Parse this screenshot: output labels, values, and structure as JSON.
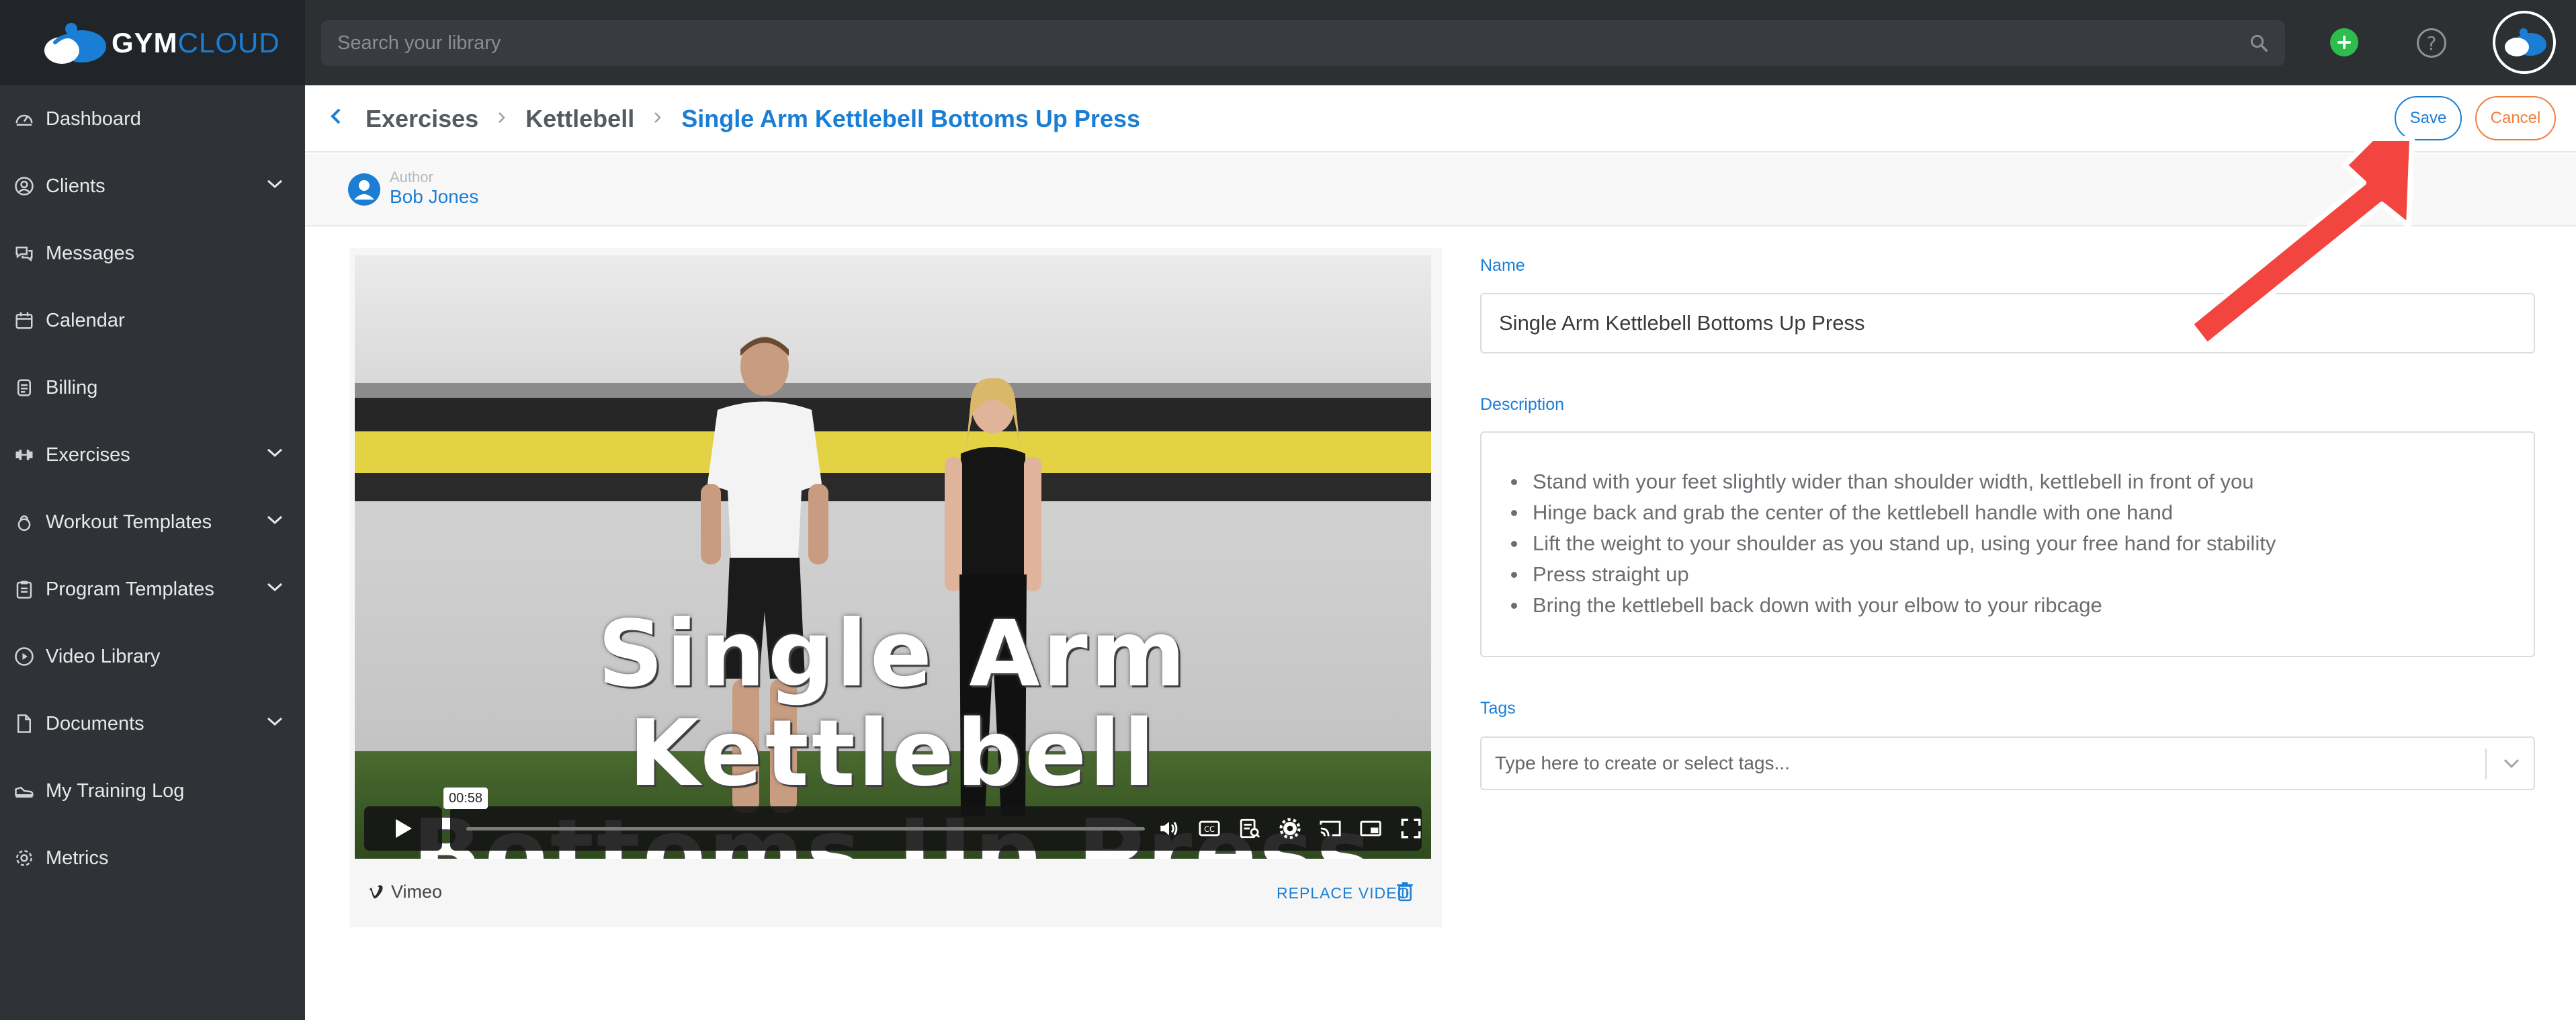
{
  "app": {
    "logo_text_left": "GYM",
    "logo_text_right": "CLOUD"
  },
  "topbar": {
    "search_placeholder": "Search your library",
    "help_glyph": "?"
  },
  "sidebar": {
    "items": [
      {
        "label": "Dashboard",
        "icon": "speedometer-icon",
        "expandable": false
      },
      {
        "label": "Clients",
        "icon": "user-circle-icon",
        "expandable": true
      },
      {
        "label": "Messages",
        "icon": "chat-bubbles-icon",
        "expandable": false
      },
      {
        "label": "Calendar",
        "icon": "calendar-icon",
        "expandable": false
      },
      {
        "label": "Billing",
        "icon": "billing-icon",
        "expandable": false
      },
      {
        "label": "Exercises",
        "icon": "dumbbell-icon",
        "expandable": true
      },
      {
        "label": "Workout Templates",
        "icon": "kettlebell-icon",
        "expandable": true
      },
      {
        "label": "Program Templates",
        "icon": "clipboard-icon",
        "expandable": true
      },
      {
        "label": "Video Library",
        "icon": "play-circle-icon",
        "expandable": false
      },
      {
        "label": "Documents",
        "icon": "document-icon",
        "expandable": true
      },
      {
        "label": "My Training Log",
        "icon": "shoe-icon",
        "expandable": false
      },
      {
        "label": "Metrics",
        "icon": "gear-icon",
        "expandable": false
      }
    ]
  },
  "breadcrumb": {
    "items": [
      "Exercises",
      "Kettlebell"
    ],
    "current": "Single Arm Kettlebell Bottoms Up Press"
  },
  "actions": {
    "save_label": "Save",
    "cancel_label": "Cancel"
  },
  "author": {
    "label": "Author",
    "name": "Bob Jones"
  },
  "video": {
    "title_line1": "Single Arm Kettlebell",
    "title_line2": "Bottoms Up Press",
    "timestamp": "00:58",
    "provider": "Vimeo",
    "replace_label": "REPLACE VIDEO"
  },
  "form": {
    "name_label": "Name",
    "name_value": "Single Arm Kettlebell Bottoms Up Press",
    "description_label": "Description",
    "description_items": [
      "Stand with your feet slightly wider than shoulder width, kettlebell in front of you",
      "Hinge back and grab the center of the kettlebell handle with one hand",
      "Lift the weight to your shoulder as you stand up, using your free hand for stability",
      "Press straight up",
      "Bring the kettlebell back down with your elbow to your ribcage"
    ],
    "tags_label": "Tags",
    "tags_placeholder": "Type here to create or select tags..."
  },
  "colors": {
    "accent": "#1a7ed4",
    "cancel": "#f07e3e",
    "add": "#2dbd4e",
    "annotation_arrow": "#f2453f"
  }
}
